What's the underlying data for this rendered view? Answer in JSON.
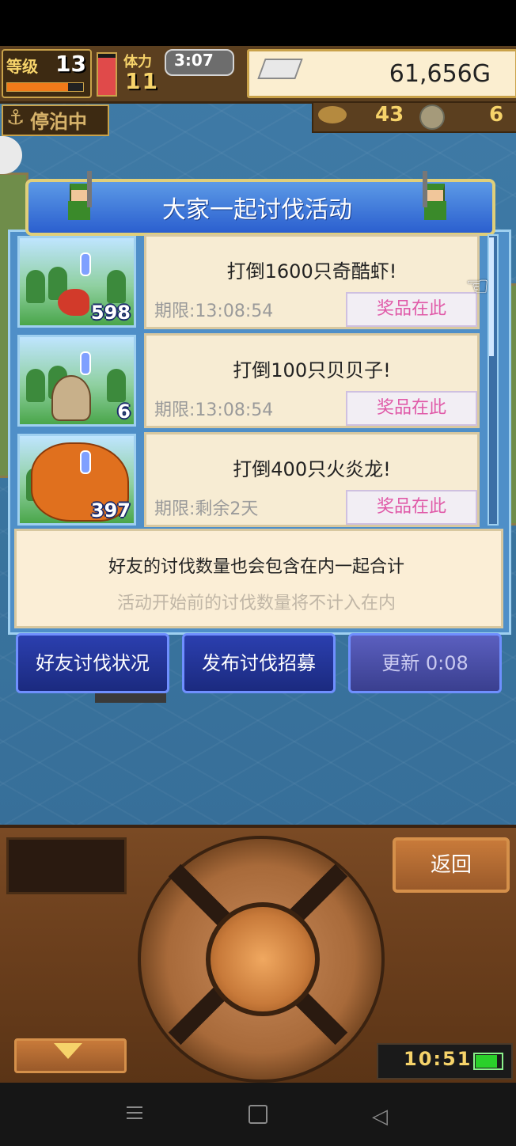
{
  "hud": {
    "level_label": "等级",
    "level": "13",
    "exp_ratio": 0.8,
    "stamina_label": "体力",
    "stamina": "11",
    "stamina_ratio": 0.9,
    "timer": "3:07",
    "gold": "61,656G"
  },
  "status_row": {
    "anchor_label": "停泊中",
    "fish_count": "43",
    "gear_count": "6"
  },
  "panel": {
    "title": "大家一起讨伐活动",
    "events": [
      {
        "name": "打倒1600只奇酷虾!",
        "deadline": "期限:13:08:54",
        "prize": "奖品在此",
        "count": "598",
        "monster": "shrimp"
      },
      {
        "name": "打倒100只贝贝子!",
        "deadline": "期限:13:08:54",
        "prize": "奖品在此",
        "count": "6",
        "monster": "shell"
      },
      {
        "name": "打倒400只火炎龙!",
        "deadline": "期限:剩余2天",
        "prize": "奖品在此",
        "count": "397",
        "monster": "dragon"
      }
    ],
    "info_main": "好友的讨伐数量也会包含在内一起合计",
    "info_sub": "活动开始前的讨伐数量将不计入在内"
  },
  "actions": {
    "friend_status": "好友讨伐状况",
    "post_recruit": "发布讨伐招募",
    "refresh": "更新 0:08"
  },
  "console": {
    "back_label": "返回",
    "clock": "10:51",
    "battery_ratio": 0.9
  },
  "colors": {
    "prize_text": "#e05aa8",
    "button_blue": "#2b3faf",
    "gold_accent": "#f6d36a"
  }
}
